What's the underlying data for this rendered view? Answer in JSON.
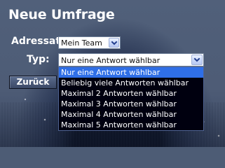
{
  "form": {
    "title": "Neue Umfrage",
    "adressat_label": "Adressat:",
    "adressat_value": "Mein Team",
    "typ_label": "Typ:",
    "typ_value": "Nur eine Antwort wählbar",
    "back_label": "Zurück"
  },
  "typ_dropdown": {
    "options": [
      "Nur eine Antwort wählbar",
      "Beliebig viele Antworten wählbar",
      "Maximal 2 Antworten wählbar",
      "Maximal 3 Antworten wählbar",
      "Maximal 4 Antworten wählbar",
      "Maximal 5 Antworten wählbar"
    ],
    "selected_index": 0
  },
  "colors": {
    "background": "#4d5c75",
    "text": "#ffffff",
    "selection": "#2f6fe7",
    "dropdown_background": "#00000f",
    "button_border": "#0d1220"
  },
  "icons": {
    "select_arrow": "chevron-down-icon",
    "background_scene": "space-night-background"
  }
}
